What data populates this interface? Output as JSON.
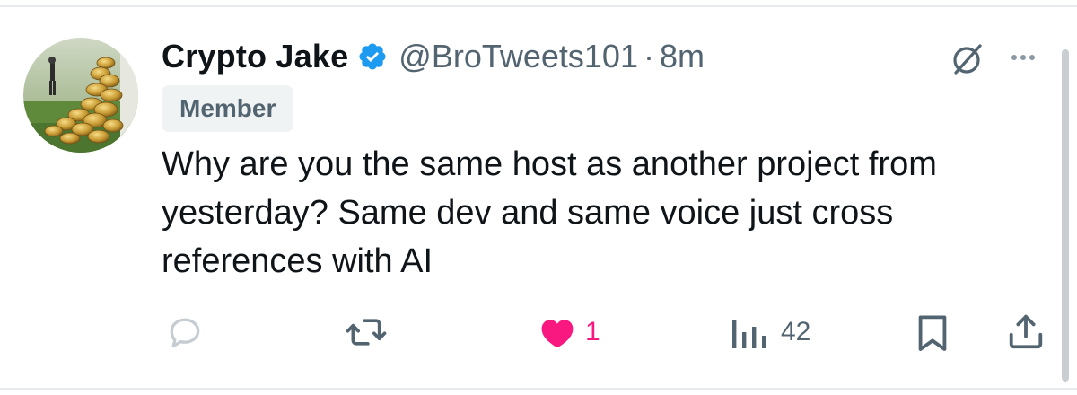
{
  "tweet": {
    "display_name": "Crypto Jake",
    "verified_icon": "verified-badge-icon",
    "handle": "@BroTweets101",
    "separator": "·",
    "time": "8m",
    "badge": "Member",
    "text": "Why are you the same host as another project from yesterday? Same dev and same voice just cross references with AI"
  },
  "actions": {
    "reply": {
      "icon": "reply-icon",
      "count": ""
    },
    "repost": {
      "icon": "repost-icon",
      "count": ""
    },
    "like": {
      "icon": "heart-icon",
      "count": "1",
      "liked": true
    },
    "views": {
      "icon": "views-icon",
      "count": "42"
    },
    "bookmark": {
      "icon": "bookmark-icon"
    },
    "share": {
      "icon": "share-icon"
    }
  },
  "colors": {
    "accent": "#1d9bf0",
    "like": "#f91880",
    "muted": "#536471",
    "text": "#0f1419"
  }
}
